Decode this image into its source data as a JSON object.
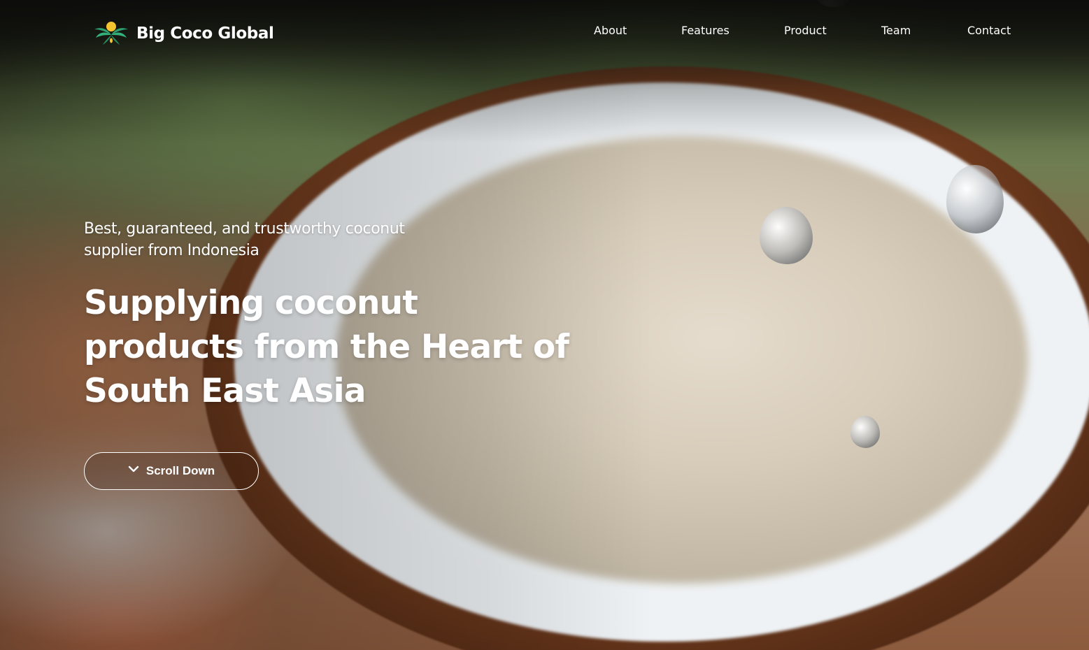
{
  "brand": {
    "name": "Big Coco Global",
    "logo_icon": "palm-tree-sun-logo",
    "colors": {
      "leaf": "#2e9f6f",
      "sun": "#f4c430"
    }
  },
  "nav": {
    "items": [
      {
        "label": "About"
      },
      {
        "label": "Features"
      },
      {
        "label": "Product"
      },
      {
        "label": "Team"
      },
      {
        "label": "Contact"
      }
    ]
  },
  "hero": {
    "tagline": "Best, guaranteed, and trustworthy coconut supplier from Indonesia",
    "headline": "Supplying coconut products from the Heart of South East Asia",
    "scroll_button": {
      "label": "Scroll Down",
      "icon": "chevron-down-icon"
    },
    "background": "coconut half with water droplets"
  }
}
